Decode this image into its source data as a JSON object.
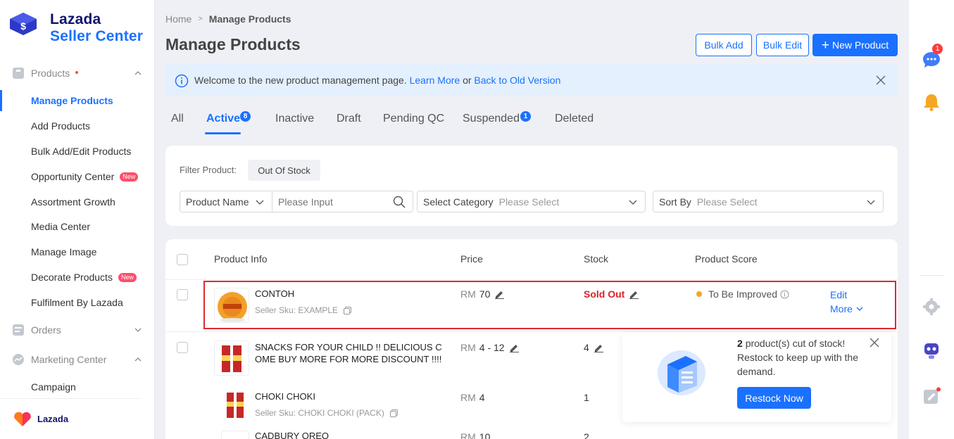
{
  "brand": {
    "line1": "Lazada",
    "line2": "Seller Center",
    "footer": "Lazada"
  },
  "sidebar": {
    "sections": [
      {
        "label": "Products",
        "icon": "products-icon"
      },
      {
        "label": "Orders",
        "icon": "orders-icon"
      },
      {
        "label": "Marketing Center",
        "icon": "marketing-icon"
      }
    ],
    "items": [
      {
        "label": "Manage Products"
      },
      {
        "label": "Add Products"
      },
      {
        "label": "Bulk Add/Edit Products"
      },
      {
        "label": "Opportunity Center",
        "badge": "New"
      },
      {
        "label": "Assortment Growth"
      },
      {
        "label": "Media Center"
      },
      {
        "label": "Manage Image"
      },
      {
        "label": "Decorate Products",
        "badge": "New"
      },
      {
        "label": "Fulfilment By Lazada"
      },
      {
        "label": "Campaign"
      }
    ]
  },
  "breadcrumb": {
    "home": "Home",
    "sep": ">",
    "current": "Manage Products"
  },
  "page_title": "Manage Products",
  "header_buttons": {
    "bulk_add": "Bulk Add",
    "bulk_edit": "Bulk Edit",
    "new_product": "New Product",
    "plus": "+"
  },
  "notice": {
    "text": "Welcome to the new product management page.",
    "learn_more": "Learn More",
    "or": "or",
    "back": "Back to Old Version"
  },
  "tabs": [
    {
      "label": "All"
    },
    {
      "label": "Active",
      "count": "8"
    },
    {
      "label": "Inactive"
    },
    {
      "label": "Draft"
    },
    {
      "label": "Pending QC"
    },
    {
      "label": "Suspended",
      "count": "1"
    },
    {
      "label": "Deleted"
    }
  ],
  "filter": {
    "label": "Filter Product:",
    "chip": "Out Of Stock",
    "product_name": "Product Name",
    "search_placeholder": "Please Input",
    "category_label": "Select Category",
    "category_placeholder": "Please Select",
    "sort_label": "Sort By",
    "sort_placeholder": "Please Select"
  },
  "table": {
    "headers": {
      "info": "Product Info",
      "price": "Price",
      "stock": "Stock",
      "score": "Product Score"
    },
    "rows": [
      {
        "name": "CONTOH",
        "sku": "Seller Sku: EXAMPLE",
        "currency": "RM",
        "price": "70",
        "stock": "Sold Out",
        "score": "To Be Improved",
        "edit": "Edit",
        "more": "More"
      },
      {
        "name_line1": "SNACKS FOR YOUR CHILD !! DELICIOUS C",
        "name_line2": "OME BUY MORE FOR MORE DISCOUNT !!!!",
        "currency": "RM",
        "price": "4 - 12",
        "stock": "4"
      },
      {
        "name": "CHOKI CHOKI",
        "sku": "Seller Sku: CHOKI CHOKI (PACK)",
        "currency": "RM",
        "price": "4",
        "stock": "1"
      },
      {
        "name": "CADBURY OREO",
        "currency": "RM",
        "price": "10",
        "stock": "2"
      }
    ]
  },
  "popover": {
    "count": "2",
    "text": "product(s) cut of stock! Restock to keep up with the demand.",
    "button": "Restock Now"
  },
  "rail": {
    "chat_badge": "1"
  },
  "colors": {
    "primary": "#1a71ff",
    "danger": "#d8232a",
    "score_dot": "#f5a623"
  }
}
